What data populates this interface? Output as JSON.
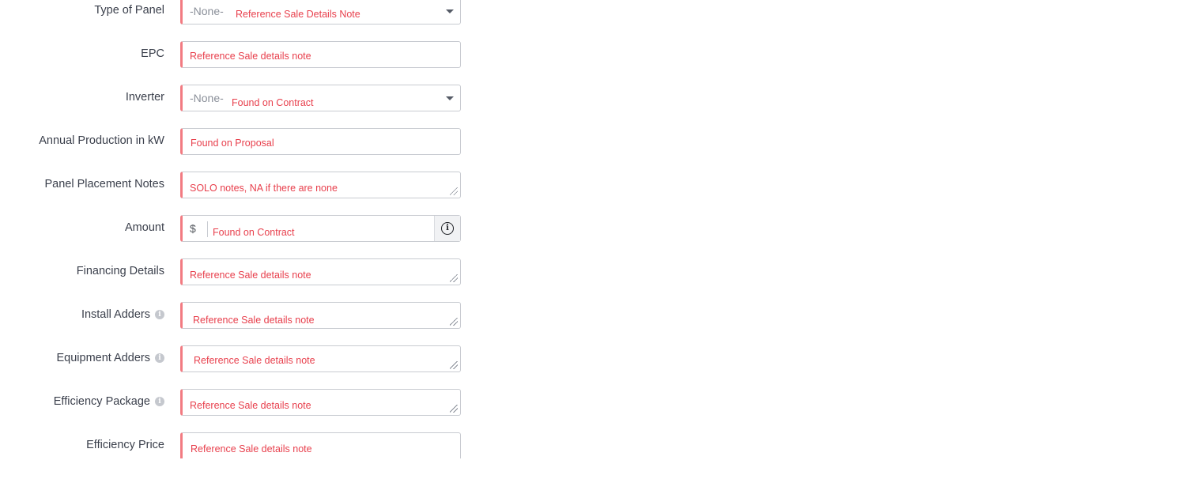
{
  "fields": [
    {
      "label": "Type of Panel",
      "kind": "select",
      "placeholder": "-None-",
      "note": "Reference Sale Details Note"
    },
    {
      "label": "EPC",
      "kind": "text",
      "note": "Reference Sale details note"
    },
    {
      "label": "Inverter",
      "kind": "select",
      "placeholder": "-None-",
      "note": "Found on Contract"
    },
    {
      "label": "Annual Production in kW",
      "kind": "text",
      "note": "Found on Proposal"
    },
    {
      "label": "Panel Placement Notes",
      "kind": "textarea",
      "note": "SOLO notes, NA if there are none"
    },
    {
      "label": "Amount",
      "kind": "currency",
      "currency_symbol": "$",
      "note": "Found on Contract",
      "info_icon": "info-icon"
    },
    {
      "label": "Financing Details",
      "kind": "textarea",
      "note": "Reference Sale details note"
    },
    {
      "label": "Install Adders",
      "kind": "textarea",
      "note": "Reference Sale details note",
      "help_icon": "help-icon"
    },
    {
      "label": "Equipment Adders",
      "kind": "textarea",
      "note": "Reference Sale details note",
      "help_icon": "help-icon"
    },
    {
      "label": "Efficiency Package",
      "kind": "textarea",
      "note": "Reference Sale details note",
      "help_icon": "help-icon"
    },
    {
      "label": "Efficiency Price",
      "kind": "text",
      "note": "Reference Sale details note"
    }
  ],
  "colors": {
    "required_border": "#f27b82",
    "note_text": "#e8404d",
    "field_border": "#c8cbd1"
  }
}
